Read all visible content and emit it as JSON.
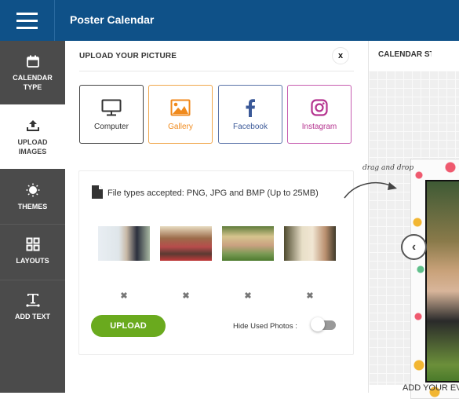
{
  "header": {
    "title": "Poster Calendar",
    "menu_icon": "hamburger-icon"
  },
  "sidebar": {
    "items": [
      {
        "label_line1": "CALENDAR",
        "label_line2": "TYPE",
        "icon": "calendar-icon",
        "active": false
      },
      {
        "label_line1": "UPLOAD",
        "label_line2": "IMAGES",
        "icon": "upload-icon",
        "active": true
      },
      {
        "label_line1": "THEMES",
        "label_line2": "",
        "icon": "sun-icon",
        "active": false
      },
      {
        "label_line1": "LAYOUTS",
        "label_line2": "",
        "icon": "grid-icon",
        "active": false
      },
      {
        "label_line1": "ADD TEXT",
        "label_line2": "",
        "icon": "text-icon",
        "active": false
      }
    ]
  },
  "panel": {
    "title": "UPLOAD YOUR PICTURE",
    "close_label": "x",
    "sources": [
      {
        "label": "Computer",
        "icon": "monitor-icon",
        "color": "#333333"
      },
      {
        "label": "Gallery",
        "icon": "image-icon",
        "color": "#f08a1c"
      },
      {
        "label": "Facebook",
        "icon": "facebook-icon",
        "color": "#3b5998"
      },
      {
        "label": "Instagram",
        "icon": "instagram-icon",
        "color": "#b5338f"
      }
    ],
    "file_info": "File types accepted: PNG, JPG and BMP (Up to 25MB)",
    "thumbnails": [
      {
        "alt": "wedding couple at gazebo"
      },
      {
        "alt": "wedding group celebration"
      },
      {
        "alt": "family picnic on grass"
      },
      {
        "alt": "bride and groom embrace"
      }
    ],
    "delete_glyph": "✖",
    "upload_label": "UPLOAD",
    "hide_used_label": "Hide Used Photos :",
    "hide_used_on": false,
    "accent_green": "#6aaa1e"
  },
  "canvas": {
    "tab_label": "CALENDAR ST",
    "drag_hint": "drag and drop",
    "prev_arrow": "‹",
    "add_event_label": "ADD YOUR EV"
  }
}
